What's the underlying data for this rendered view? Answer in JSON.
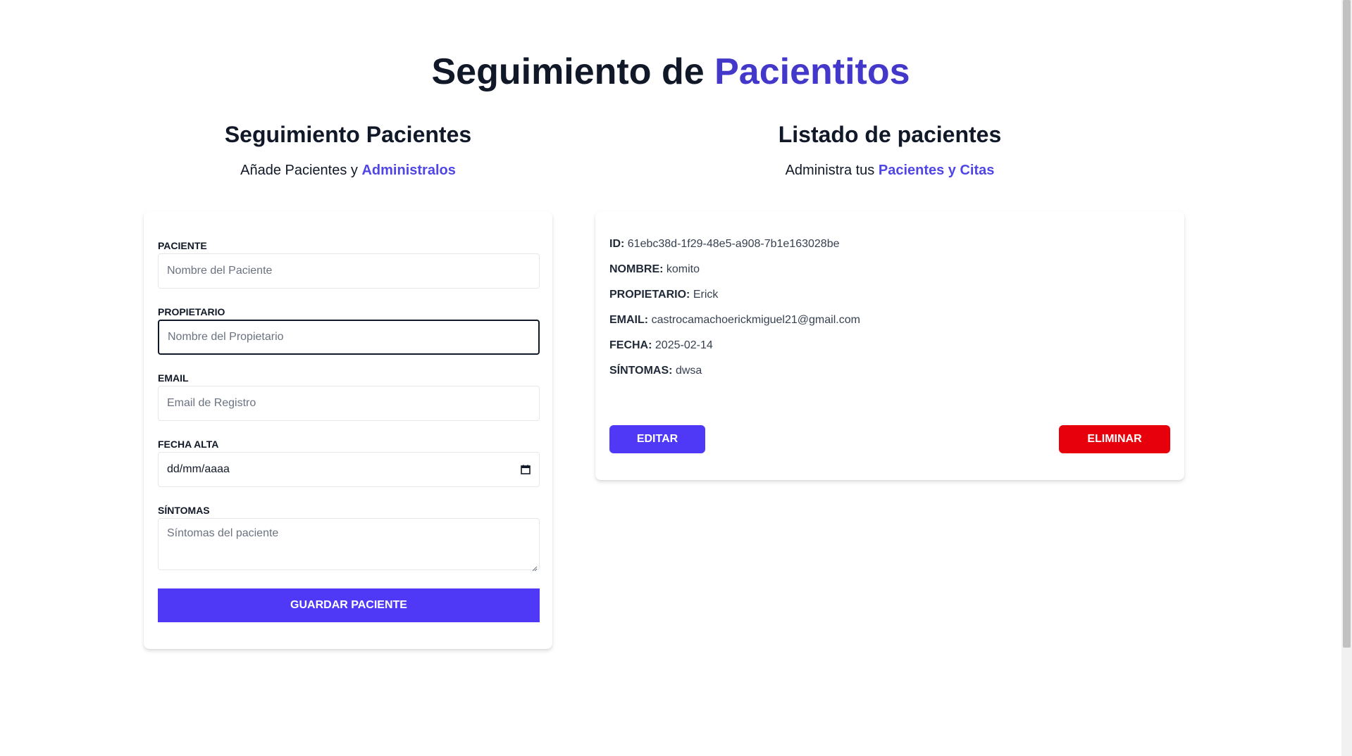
{
  "header": {
    "title_part1": "Seguimiento de ",
    "title_part2": "Pacientitos"
  },
  "form_section": {
    "heading": "Seguimiento Pacientes",
    "subtitle_part1": "Añade Pacientes y ",
    "subtitle_part2": "Administralos"
  },
  "list_section": {
    "heading": "Listado de pacientes",
    "subtitle_part1": "Administra tus ",
    "subtitle_part2": "Pacientes y Citas"
  },
  "form": {
    "fields": [
      {
        "label": "PACIENTE",
        "placeholder": "Nombre del Paciente",
        "value": ""
      },
      {
        "label": "PROPIETARIO",
        "placeholder": "Nombre del Propietario",
        "value": ""
      },
      {
        "label": "EMAIL",
        "placeholder": "Email de Registro",
        "value": ""
      },
      {
        "label": "FECHA ALTA",
        "placeholder": "dd/mm/aaaa",
        "value": ""
      },
      {
        "label": "SÍNTOMAS",
        "placeholder": "Síntomas del paciente",
        "value": ""
      }
    ],
    "submit_label": "GUARDAR PACIENTE",
    "calendar_icon": "calendar-icon"
  },
  "patients": [
    {
      "id_label": "ID:",
      "id": "61ebc38d-1f29-48e5-a908-7b1e163028be",
      "name_label": "NOMBRE:",
      "name": "komito",
      "owner_label": "PROPIETARIO:",
      "owner": "Erick",
      "email_label": "EMAIL:",
      "email": "castrocamachoerickmiguel21@gmail.com",
      "date_label": "FECHA:",
      "date": "2025-02-14",
      "symptoms_label": "SÍNTOMAS:",
      "symptoms": "dwsa",
      "edit_label": "EDITAR",
      "delete_label": "ELIMINAR"
    }
  ],
  "colors": {
    "accent": "#4338ca",
    "primary_button": "#4f39f6",
    "danger_button": "#e7000b"
  }
}
